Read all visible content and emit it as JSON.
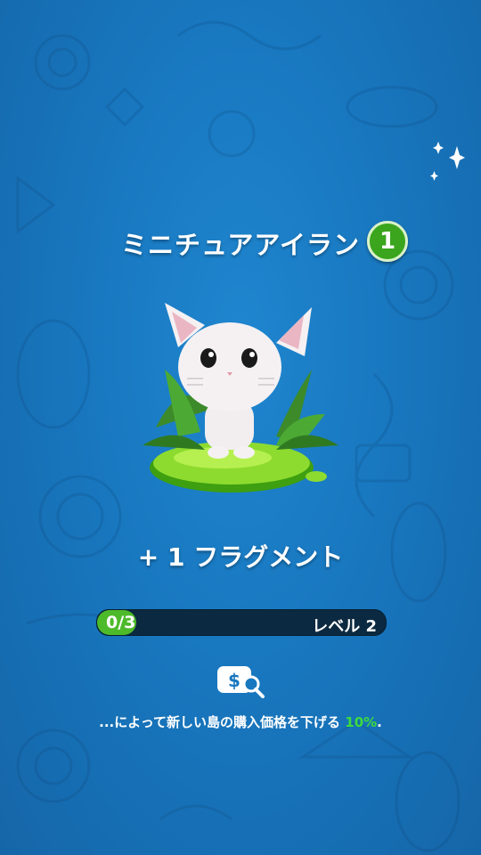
{
  "pet": {
    "name": "ミニチュアアイラン",
    "level": "1",
    "icon": "white-cat-on-grass"
  },
  "reward": {
    "fragment_label": "+ 1 フラグメント"
  },
  "progress": {
    "count": "0/3",
    "fraction": 0.0,
    "level_label": "レベル 2"
  },
  "bonus": {
    "icon": "price-tag-search-icon",
    "description": "...によって新しい島の購入価格を下げる",
    "percent": "10%",
    "suffix": "."
  },
  "colors": {
    "background": "#1877bf",
    "accent_green": "#3aa51d",
    "percent_green": "#3ddc3d",
    "bar_track": "#0b2940"
  }
}
